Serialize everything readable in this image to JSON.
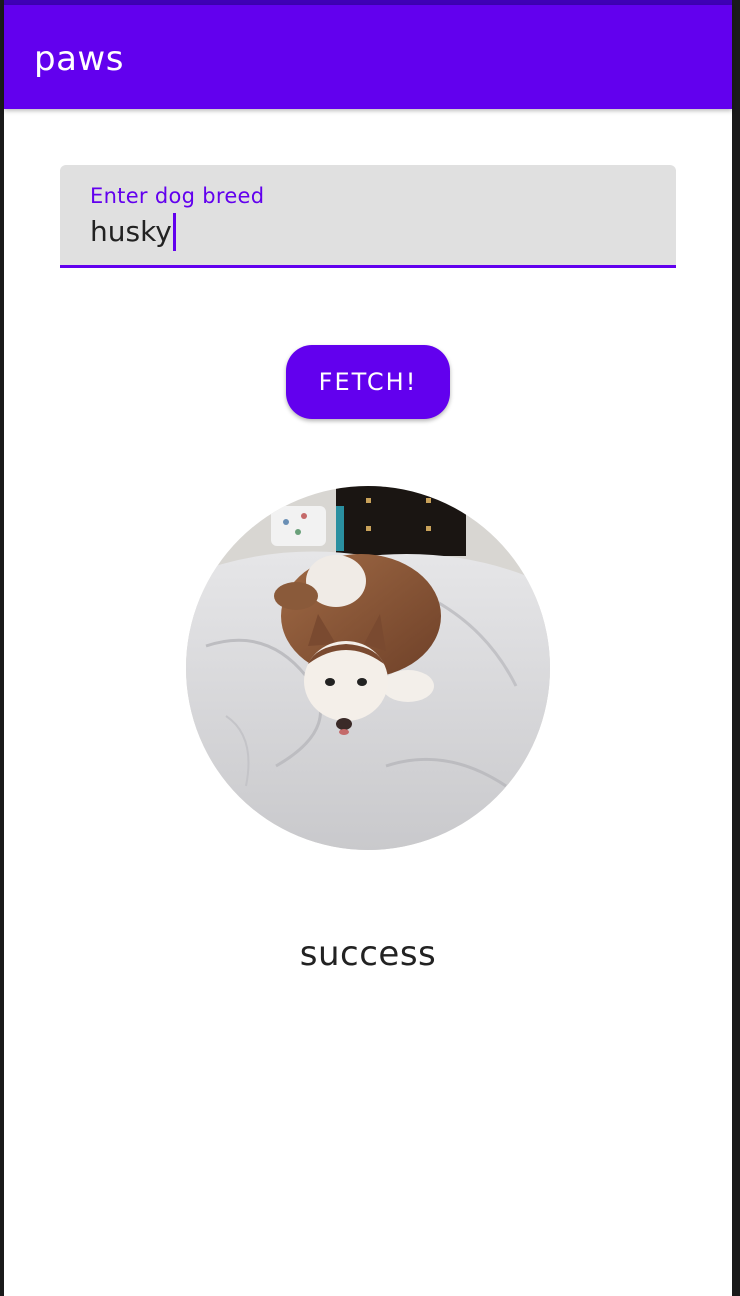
{
  "app_bar": {
    "title": "paws",
    "color": "#6200ee"
  },
  "breed_field": {
    "label": "Enter dog breed",
    "value": "husky"
  },
  "fetch_button": {
    "label": "FETCH!"
  },
  "dog_image": {
    "subject": "husky lying on bed"
  },
  "status": {
    "text": "success"
  },
  "colors": {
    "primary": "#6200ee",
    "field_bg": "#e0e0e0",
    "text": "#222222"
  }
}
